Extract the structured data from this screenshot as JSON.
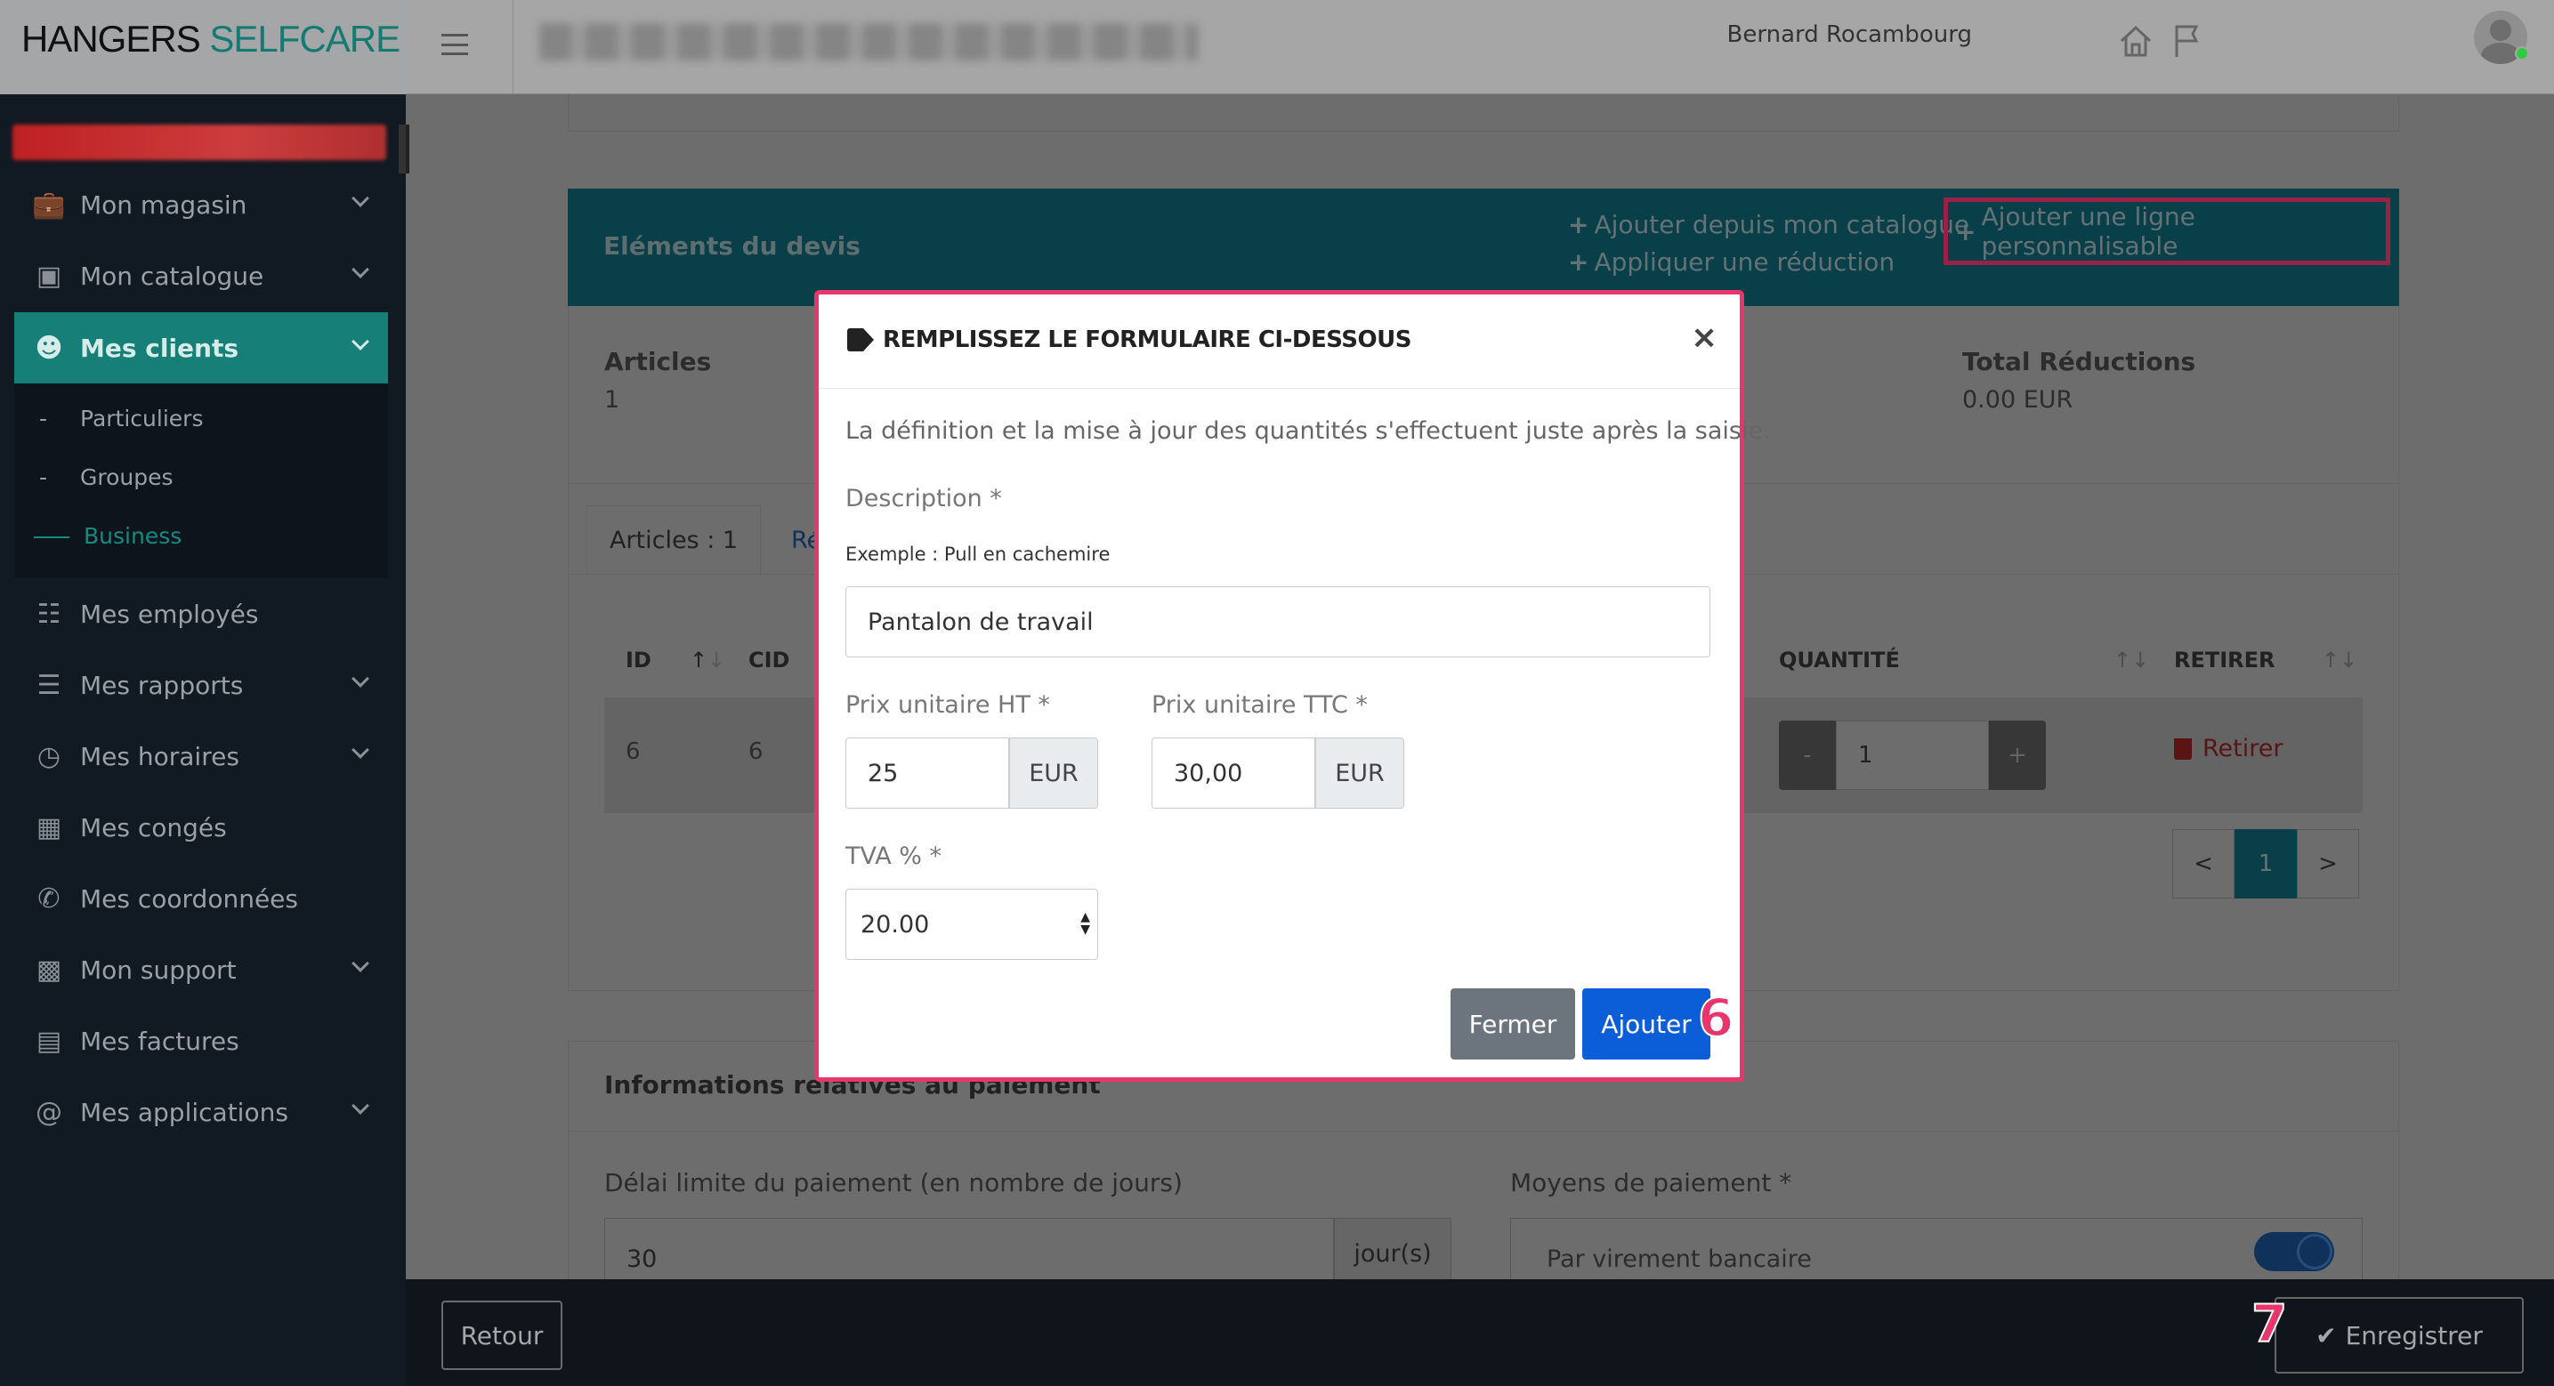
{
  "brand": {
    "part1": "HANGERS",
    "part2": " SELFCARE"
  },
  "header": {
    "user_name": "Bernard Rocambourg"
  },
  "sidebar": {
    "items": [
      {
        "label": "Mon magasin",
        "icon": "briefcase-icon",
        "has_chevron": true
      },
      {
        "label": "Mon catalogue",
        "icon": "box-icon",
        "has_chevron": true
      },
      {
        "label": "Mes clients",
        "icon": "users-icon",
        "has_chevron": true,
        "active": true
      },
      {
        "label": "Mes employés",
        "icon": "book-icon",
        "has_chevron": false
      },
      {
        "label": "Mes rapports",
        "icon": "list-icon",
        "has_chevron": true
      },
      {
        "label": "Mes horaires",
        "icon": "clock-icon",
        "has_chevron": true
      },
      {
        "label": "Mes congés",
        "icon": "calendar-icon",
        "has_chevron": false
      },
      {
        "label": "Mes coordonnées",
        "icon": "phone-icon",
        "has_chevron": false
      },
      {
        "label": "Mon support",
        "icon": "chat-icon",
        "has_chevron": true
      },
      {
        "label": "Mes factures",
        "icon": "invoice-icon",
        "has_chevron": false
      },
      {
        "label": "Mes applications",
        "icon": "at-icon",
        "has_chevron": true
      }
    ],
    "subitems": [
      {
        "label": "Particuliers",
        "active": false
      },
      {
        "label": "Groupes",
        "active": false
      },
      {
        "label": "Business",
        "active": true
      }
    ]
  },
  "quote": {
    "title": "Eléments du devis",
    "add_from_catalog": "Ajouter depuis mon catalogue",
    "add_custom_line": "Ajouter une ligne personnalisable",
    "apply_discount": "Appliquer une réduction",
    "articles_label": "Articles",
    "articles_value": "1",
    "total_discounts_label": "Total Réductions",
    "total_discounts_value": "0.00 EUR",
    "tab_articles": "Articles : 1",
    "tab_other": "Ré",
    "columns": {
      "id": "ID",
      "cid": "CID",
      "quantity": "QUANTITÉ",
      "remove": "RETIRER"
    },
    "row": {
      "id": "6",
      "cid": "6",
      "quantity": "1",
      "remove_label": "Retirer"
    },
    "pagination": {
      "prev": "<",
      "current": "1",
      "next": ">"
    },
    "qty_minus": "-",
    "qty_plus": "+"
  },
  "payment": {
    "title": "Informations relatives au paiement",
    "delay_label": "Délai limite du paiement (en nombre de jours)",
    "delay_value": "30",
    "delay_unit": "jour(s)",
    "methods_label": "Moyens de paiement *",
    "method_transfer": "Par virement bancaire"
  },
  "modal": {
    "title": "REMPLISSEZ LE FORMULAIRE CI-DESSOUS",
    "close_symbol": "×",
    "intro": "La définition et la mise à jour des quantités s'effectuent juste après la saisie.",
    "description_label": "Description *",
    "description_hint": "Exemple : Pull en cachemire",
    "description_value": "Pantalon de travail",
    "price_ht_label": "Prix unitaire HT *",
    "price_ht_value": "25",
    "price_ttc_label": "Prix unitaire TTC *",
    "price_ttc_value": "30,00",
    "currency": "EUR",
    "vat_label": "TVA % *",
    "vat_value": "20.00",
    "close_button": "Fermer",
    "add_button": "Ajouter"
  },
  "footer": {
    "back_button": "Retour",
    "save_button": "Enregistrer"
  },
  "steps": {
    "six": "6",
    "seven": "7"
  },
  "colors": {
    "teal": "#167f78",
    "accent_pink": "#e8356b",
    "primary_blue": "#0b5ed7",
    "danger_red": "#c0392b"
  }
}
